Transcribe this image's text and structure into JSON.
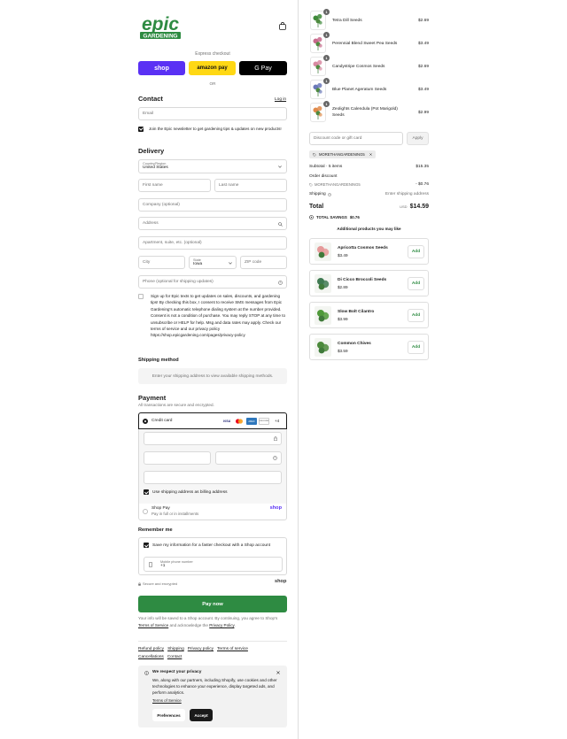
{
  "brand": {
    "logo_line1": "epic",
    "logo_line2": "GARDENING",
    "colors": {
      "primary": "#2e8b42",
      "shop": "#5a31f4",
      "amazon": "#ffd814"
    }
  },
  "express": {
    "label": "Express checkout",
    "shop": "shop",
    "amazon": "amazon pay",
    "gpay": "G Pay",
    "or": "OR"
  },
  "contact": {
    "title": "Contact",
    "login": "Log in",
    "email_placeholder": "Email",
    "newsletter": "Join the Epic newsletter to get gardening tips & updates on new products!"
  },
  "delivery": {
    "title": "Delivery",
    "country_label": "Country/Region",
    "country_value": "United States",
    "first_name": "First name",
    "last_name": "Last name",
    "company": "Company (optional)",
    "address": "Address",
    "apartment": "Apartment, suite, etc. (optional)",
    "city": "City",
    "state_label": "State",
    "state_value": "Iowa",
    "zip": "ZIP code",
    "phone": "Phone (optional for shipping updates)",
    "sms_text": "Sign up for Epic texts to get updates on sales, discounts, and gardening tips! By checking this box, I consent to receive SMS messages from Epic Gardening's automatic telephone dialing system at the number provided. Consent is not a condition of purchase. You may reply STOP at any time to unsubscribe or HELP for help. Msg and data rates may apply. Check our terms of service and our privacy policy https://shop.epicgardening.com/pages/privacy-policy"
  },
  "shipping_method": {
    "title": "Shipping method",
    "note": "Enter your shipping address to view available shipping methods."
  },
  "payment": {
    "title": "Payment",
    "subtitle": "All transactions are secure and encrypted.",
    "credit_card": "Credit card",
    "cards": [
      "VISA",
      "MC",
      "AMEX",
      "DISCOVER"
    ],
    "more_cards": "+4",
    "billing_same": "Use shipping address as billing address",
    "shoppay_title": "Shop Pay",
    "shoppay_sub": "Pay in full or in installments",
    "shoppay_logo": "shop"
  },
  "remember": {
    "title": "Remember me",
    "save_info": "Save my information for a faster checkout with a Shop account",
    "mobile_label": "Mobile phone number",
    "mobile_value": "+1",
    "secure": "Secure and encrypted",
    "shop_logo": "shop"
  },
  "paynow": {
    "label": "Pay now",
    "disclaimer_1": "Your info will be saved to a Shop account. By continuing, you agree to Shop's ",
    "terms": "Terms of Service",
    "disclaimer_2": " and acknowledge the ",
    "privacy": "Privacy Policy",
    "disclaimer_3": "."
  },
  "footer_links": [
    "Refund policy",
    "Shipping",
    "Privacy policy",
    "Terms of service",
    "Cancellations",
    "Contact"
  ],
  "cookie": {
    "title": "We respect your privacy",
    "text": "We, along with our partners, including Shopify, use cookies and other technologies to enhance your experience, display targeted ads, and perform analytics.",
    "terms": "Terms of Service",
    "preferences": "Preferences",
    "accept": "Accept"
  },
  "cart": {
    "items": [
      {
        "qty": "1",
        "name": "Tetra Dill Seeds",
        "price": "$2.69",
        "color": "#3f8a3a"
      },
      {
        "qty": "1",
        "name": "Perennial Blend Sweet Pea Seeds",
        "price": "$3.49",
        "color": "#c86a8c"
      },
      {
        "qty": "1",
        "name": "Candystripe Cosmos Seeds",
        "price": "$2.69",
        "color": "#d98aa2"
      },
      {
        "qty": "1",
        "name": "Blue Planet Ageratum Seeds",
        "price": "$3.49",
        "color": "#6a78b8"
      },
      {
        "qty": "1",
        "name": "Zeolights Calendula (Pot Marigold) Seeds",
        "price": "$2.99",
        "color": "#e08a4a"
      }
    ],
    "discount_placeholder": "Discount code or gift card",
    "apply": "Apply",
    "code_tag": "MORETHANGARDENING5",
    "subtotal_label": "Subtotal · 5 items",
    "subtotal": "$15.35",
    "order_discount": "Order discount",
    "discount_code": "MORETHANGARDENING5",
    "discount_value": "- $0.76",
    "shipping_label": "Shipping",
    "shipping_value": "Enter shipping address",
    "total_label": "Total",
    "currency": "USD",
    "total": "$14.59",
    "savings_label": "TOTAL SAVINGS",
    "savings": "$0.76",
    "additional_title": "Additional products you may like",
    "recommendations": [
      {
        "name": "Apricotta Cosmos Seeds",
        "price": "$3.49",
        "add": "Add",
        "color": "#e69a9a"
      },
      {
        "name": "Di Cicco Broccoli Seeds",
        "price": "$2.89",
        "add": "Add",
        "color": "#3f7a52"
      },
      {
        "name": "Slow Bolt Cilantro",
        "price": "$3.99",
        "add": "Add",
        "color": "#4f9a3a"
      },
      {
        "name": "Common Chives",
        "price": "$3.59",
        "add": "Add",
        "color": "#4c8a3c"
      }
    ]
  }
}
